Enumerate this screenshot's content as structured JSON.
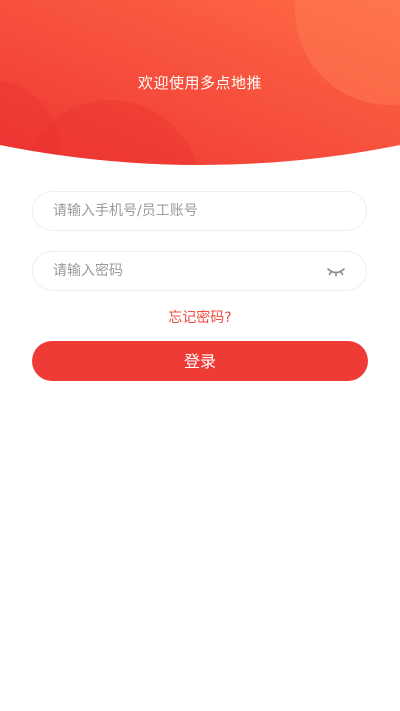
{
  "header": {
    "welcome_text": "欢迎使用多点地推"
  },
  "login_form": {
    "account_placeholder": "请输入手机号/员工账号",
    "account_value": "",
    "password_placeholder": "请输入密码",
    "password_value": "",
    "password_toggle_icon": "eye-closed-icon",
    "forgot_password_label": "忘记密码?",
    "login_button_label": "登录"
  },
  "colors": {
    "brand_gradient_start": "#ef3a35",
    "brand_gradient_end": "#ff6a45",
    "primary_button": "#ef3b36",
    "link": "#f24b3c"
  }
}
